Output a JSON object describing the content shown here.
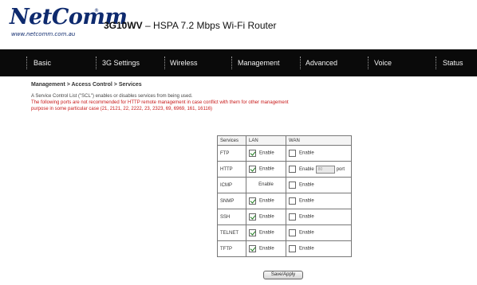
{
  "header": {
    "logo_text": "NetComm",
    "logo_tm": "®",
    "logo_url": "www.netcomm.com.au",
    "product_model": "3G10WV",
    "product_desc": " – HSPA 7.2 Mbps Wi-Fi Router"
  },
  "nav": {
    "items": [
      "Basic",
      "3G Settings",
      "Wireless",
      "Management",
      "Advanced",
      "Voice",
      "Status"
    ]
  },
  "page": {
    "breadcrumb": "Management > Access Control > Services",
    "description": "A Service Control List (\"SCL\") enables or disables services from being used.",
    "warning": "The following ports are not recommended for HTTP remote management in case conflict with them for other management purpose in some particular case (21, 2121, 22, 2222, 23, 2323, 69, 6969, 161, 16116)"
  },
  "table": {
    "headers": {
      "services": "Services",
      "lan": "LAN",
      "wan": "WAN"
    },
    "enable_label": "Enable",
    "port_label": "port",
    "http_port_value": "80",
    "rows": [
      {
        "service": "FTP",
        "lan_checked": true,
        "wan_checked": false
      },
      {
        "service": "HTTP",
        "lan_checked": true,
        "wan_checked": false
      },
      {
        "service": "ICMP",
        "lan_checked": null,
        "wan_checked": false
      },
      {
        "service": "SNMP",
        "lan_checked": true,
        "wan_checked": false
      },
      {
        "service": "SSH",
        "lan_checked": true,
        "wan_checked": false
      },
      {
        "service": "TELNET",
        "lan_checked": true,
        "wan_checked": false
      },
      {
        "service": "TFTP",
        "lan_checked": true,
        "wan_checked": false
      }
    ]
  },
  "actions": {
    "save_apply_label": "Save/Apply"
  },
  "colors": {
    "navbar_bg": "#0a0a0a",
    "logo_blue": "#0e2a6e",
    "warning_red": "#c81818",
    "check_green": "#1a7a1a"
  }
}
